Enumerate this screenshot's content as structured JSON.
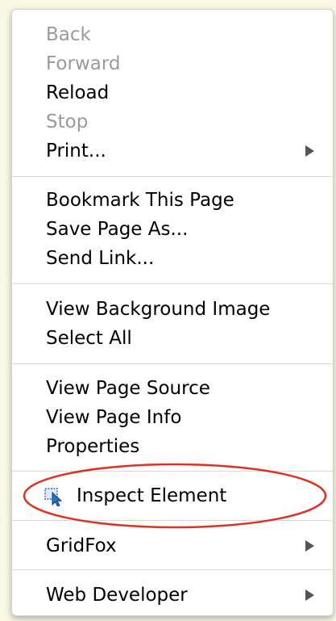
{
  "menu": {
    "section1": {
      "back": "Back",
      "forward": "Forward",
      "reload": "Reload",
      "stop": "Stop",
      "print": "Print..."
    },
    "section2": {
      "bookmark": "Bookmark This Page",
      "save_page": "Save Page As...",
      "send_link": "Send Link..."
    },
    "section3": {
      "view_background": "View Background Image",
      "select_all": "Select All"
    },
    "section4": {
      "view_source": "View Page Source",
      "view_info": "View Page Info",
      "properties": "Properties"
    },
    "inspect": {
      "label": "Inspect Element",
      "icon": "inspect-cursor-icon"
    },
    "gridfox": "GridFox",
    "web_developer": "Web Developer"
  },
  "colors": {
    "disabled_text": "#9a9a9a",
    "highlight_ring": "#e0301e",
    "icon_blue": "#2a6fc9"
  }
}
